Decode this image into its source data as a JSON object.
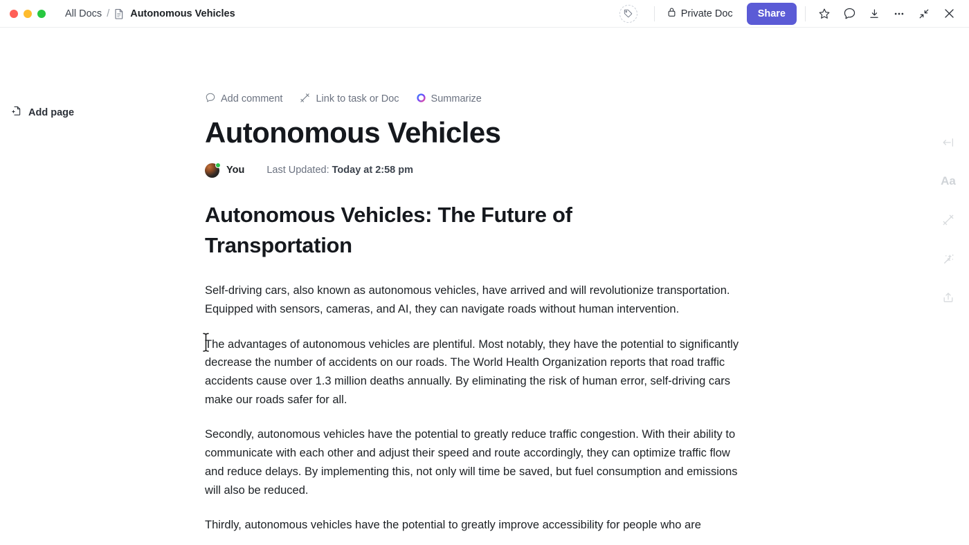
{
  "window": {
    "traffic_lights": [
      "close",
      "minimize",
      "maximize"
    ],
    "colors": {
      "close": "#ff5f57",
      "minimize": "#febc2e",
      "maximize": "#28c840",
      "accent": "#5b5bd6"
    }
  },
  "breadcrumb": {
    "root_label": "All Docs",
    "separator": "/",
    "current_label": "Autonomous Vehicles",
    "doc_icon": "document-icon"
  },
  "titlebar": {
    "tag_icon": "tag-icon",
    "privacy_label": "Private Doc",
    "privacy_icon": "lock-icon",
    "share_label": "Share",
    "icons": [
      {
        "name": "star-icon",
        "label": "Favorite"
      },
      {
        "name": "comment-icon",
        "label": "Comments"
      },
      {
        "name": "collapse-down-icon",
        "label": "Minimize to tray"
      },
      {
        "name": "more-options-icon",
        "label": "More"
      },
      {
        "name": "shrink-icon",
        "label": "Exit full screen"
      },
      {
        "name": "close-icon",
        "label": "Close"
      }
    ]
  },
  "sidebar": {
    "add_page_label": "Add page",
    "add_page_icon": "add-page-icon"
  },
  "doc_actions": [
    {
      "name": "add-comment",
      "label": "Add comment",
      "icon": "comment-icon"
    },
    {
      "name": "link-to-task",
      "label": "Link to task or Doc",
      "icon": "link-icon"
    },
    {
      "name": "summarize",
      "label": "Summarize",
      "icon": "ai-sparkle-icon"
    }
  ],
  "doc": {
    "title": "Autonomous Vehicles",
    "byline": {
      "author": "You",
      "updated_prefix": "Last Updated:",
      "updated_value": "Today at 2:58 pm",
      "avatar": "user-avatar",
      "presence": "online"
    },
    "section_title": "Autonomous Vehicles: The Future of Transportation",
    "paragraphs": [
      "Self-driving cars, also known as autonomous vehicles, have arrived and will revolutionize transportation. Equipped with sensors, cameras, and AI, they can navigate roads without human intervention.",
      "The advantages of autonomous vehicles are plentiful. Most notably, they have the potential to significantly decrease the number of accidents on our roads. The World Health Organization reports that road traffic accidents cause over 1.3 million deaths annually. By eliminating the risk of human error, self-driving cars make our roads safer for all.",
      "Secondly, autonomous vehicles have the potential to greatly reduce traffic congestion. With their ability to communicate with each other and adjust their speed and route accordingly, they can optimize traffic flow and reduce delays. By implementing this, not only will time be saved, but fuel consumption and emissions will also be reduced.",
      "Thirdly, autonomous vehicles have the potential to greatly improve accessibility for people who are"
    ]
  },
  "right_rail": [
    {
      "name": "collapse-panel-icon",
      "label": "Collapse"
    },
    {
      "name": "font-size-icon",
      "label": "Aa"
    },
    {
      "name": "link-icon",
      "label": "Link"
    },
    {
      "name": "magic-wand-icon",
      "label": "AI"
    },
    {
      "name": "share-upload-icon",
      "label": "Share"
    }
  ]
}
